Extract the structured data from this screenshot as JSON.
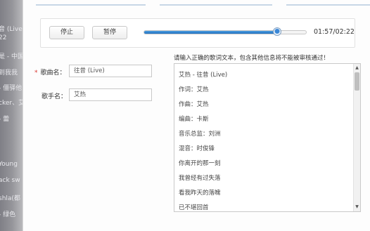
{
  "background_list": {
    "items": [
      "音 (Live",
      "22",
      "是 - 中国",
      "到我我",
      "- 僵驿他",
      "cker、艾",
      "- 蕾",
      "Young",
      "ack sw",
      "shla(都",
      "- 绿色"
    ]
  },
  "player": {
    "stop_label": "停止",
    "pause_label": "暂停",
    "time": "01:57/02:22",
    "progress_fraction": 0.82,
    "accent_color": "#2a7cc7"
  },
  "form": {
    "song_name_label": "歌曲名：",
    "song_name_required_mark": "*",
    "song_name_value": "往昔 (Live)",
    "singer_label": "歌手名：",
    "singer_value": "艾热"
  },
  "lyrics": {
    "notice": "请输入正确的歌词文本，包含其他信息将不能被审核通过！",
    "lines": [
      "艾热 - 往昔 (Live)",
      "作词：艾热",
      "作曲：艾热",
      "编曲：卡斯",
      "音乐总监：刘洲",
      "混音：时俊锋",
      "你离开的那一刻",
      "我曾经有过失落",
      "看我昨天的落魄",
      "已不堪回首"
    ]
  }
}
